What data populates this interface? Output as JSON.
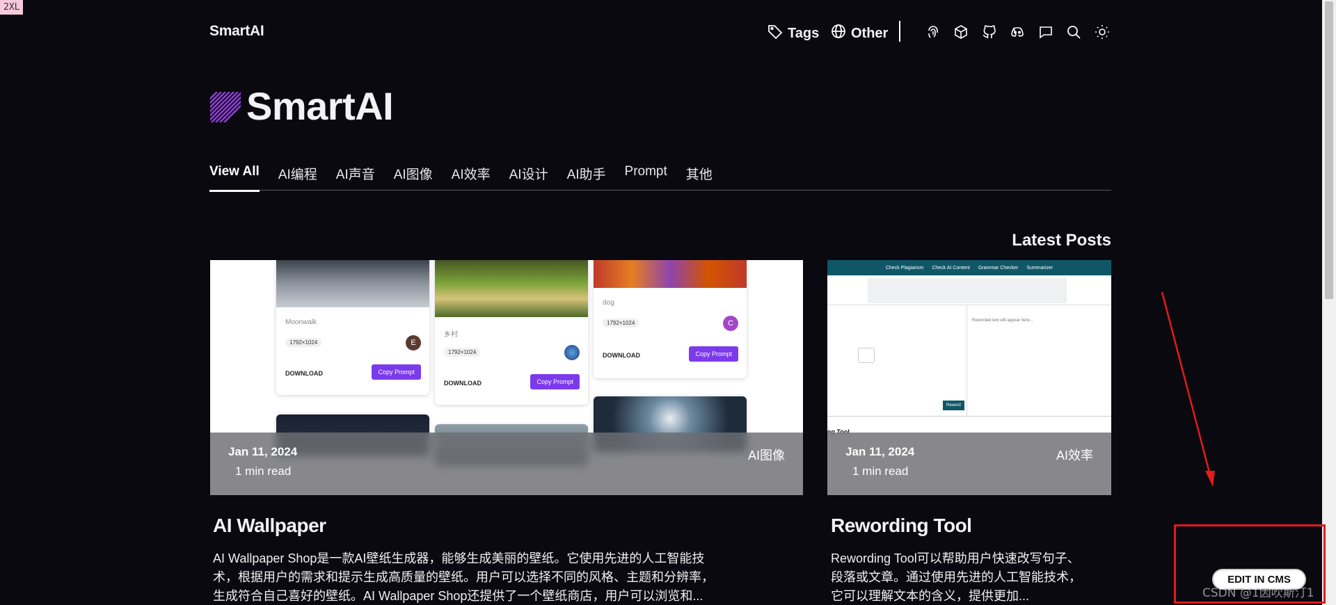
{
  "breakpoint_badge": "2XL",
  "header": {
    "logo": "SmartAI",
    "nav": [
      {
        "label": "Tags",
        "icon": "tag-icon"
      },
      {
        "label": "Other",
        "icon": "globe-icon"
      }
    ],
    "icons": [
      "fingerprint-icon",
      "cube-icon",
      "github-icon",
      "discord-icon",
      "chat-icon",
      "search-icon",
      "sun-icon"
    ]
  },
  "hero": {
    "title": "SmartAI"
  },
  "tabs": [
    "View All",
    "AI编程",
    "AI声音",
    "AI图像",
    "AI效率",
    "AI设计",
    "AI助手",
    "Prompt",
    "其他"
  ],
  "section_title": "Latest Posts",
  "posts": [
    {
      "date": "Jan 11, 2024",
      "read_time": "1 min read",
      "tag": "AI图像",
      "title": "AI Wallpaper",
      "description": "AI Wallpaper Shop是一款AI壁纸生成器，能够生成美丽的壁纸。它使用先进的人工智能技术，根据用户的需求和提示生成高质量的壁纸。用户可以选择不同的风格、主题和分辨率，生成符合自己喜好的壁纸。AI Wallpaper Shop还提供了一个壁纸商店，用户可以浏览和...",
      "thumbnail": {
        "cards": [
          {
            "name": "Moonwalk",
            "size": "1792×1024",
            "avatar": "E",
            "download": "DOWNLOAD",
            "copy": "Copy Prompt"
          },
          {
            "name": "乡村",
            "size": "1792×1024",
            "avatar": "",
            "download": "DOWNLOAD",
            "copy": "Copy Prompt"
          },
          {
            "name": "dog",
            "size": "1792×1024",
            "avatar": "C",
            "download": "DOWNLOAD",
            "copy": "Copy Prompt"
          }
        ]
      }
    },
    {
      "date": "Jan 11, 2024",
      "read_time": "1 min read",
      "tag": "AI效率",
      "title": "Rewording Tool",
      "description": "Rewording Tool可以帮助用户快速改写句子、段落或文章。通过使用先进的人工智能技术，它可以理解文本的含义，提供更加...",
      "thumbnail": {
        "menu": [
          "Check Plagiarism",
          "Check AI Content",
          "Grammar Checker",
          "Summarizer"
        ],
        "output_placeholder": "Reworded text will appear here...",
        "button": "Reword",
        "footer_text": "ng Tool"
      }
    }
  ],
  "cms_button": "EDIT IN CMS",
  "watermark": "CSDN @1因吹斯汀1"
}
